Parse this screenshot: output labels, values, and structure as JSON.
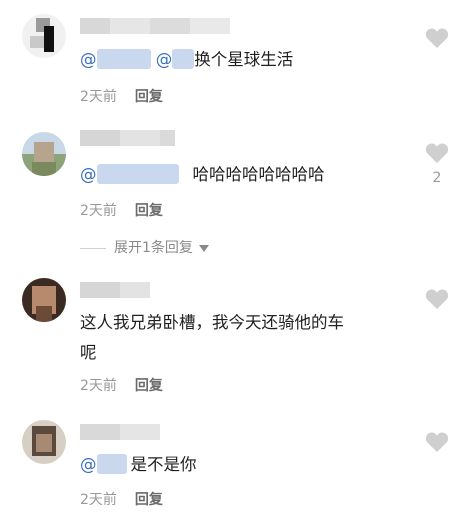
{
  "comments": [
    {
      "text": "换个星球生活",
      "mention_prefix": "@",
      "mention_prefix2": "@",
      "time": "2天前",
      "reply": "回复",
      "likes": ""
    },
    {
      "text": "哈哈哈哈哈哈哈哈",
      "mention_prefix": "@",
      "time": "2天前",
      "reply": "回复",
      "likes": "2"
    },
    {
      "text_line1": "这人我兄弟卧槽，我今天还骑他的车",
      "text_line2": "呢",
      "time": "2天前",
      "reply": "回复",
      "likes": ""
    },
    {
      "text": "是不是你",
      "mention_prefix": "@",
      "time": "2天前",
      "reply": "回复",
      "likes": ""
    }
  ],
  "expand_replies": "展开1条回复",
  "colors": {
    "mention": "#3b6fbf",
    "heart": "#cfcfcf",
    "meta": "#9a9a9a"
  },
  "icons": {
    "like": "heart-icon",
    "expand": "triangle-down-icon"
  }
}
